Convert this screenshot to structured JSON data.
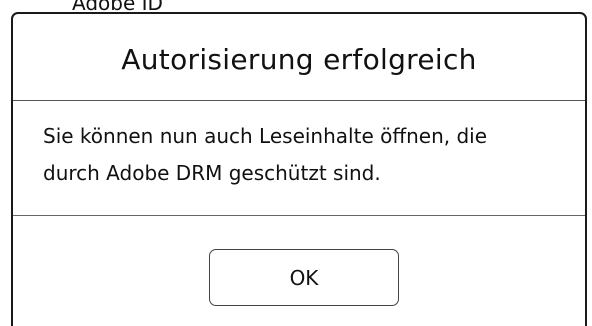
{
  "background_text": "Adobe ID",
  "dialog": {
    "title": "Autorisierung erfolgreich",
    "message_line1": "Sie können nun auch Leseinhalte öffnen, die",
    "message_line2": "durch Adobe DRM geschützt sind.",
    "ok_label": "OK"
  },
  "colors": {
    "background": "#ffffff",
    "text": "#111111",
    "border": "#1a1a1a"
  }
}
